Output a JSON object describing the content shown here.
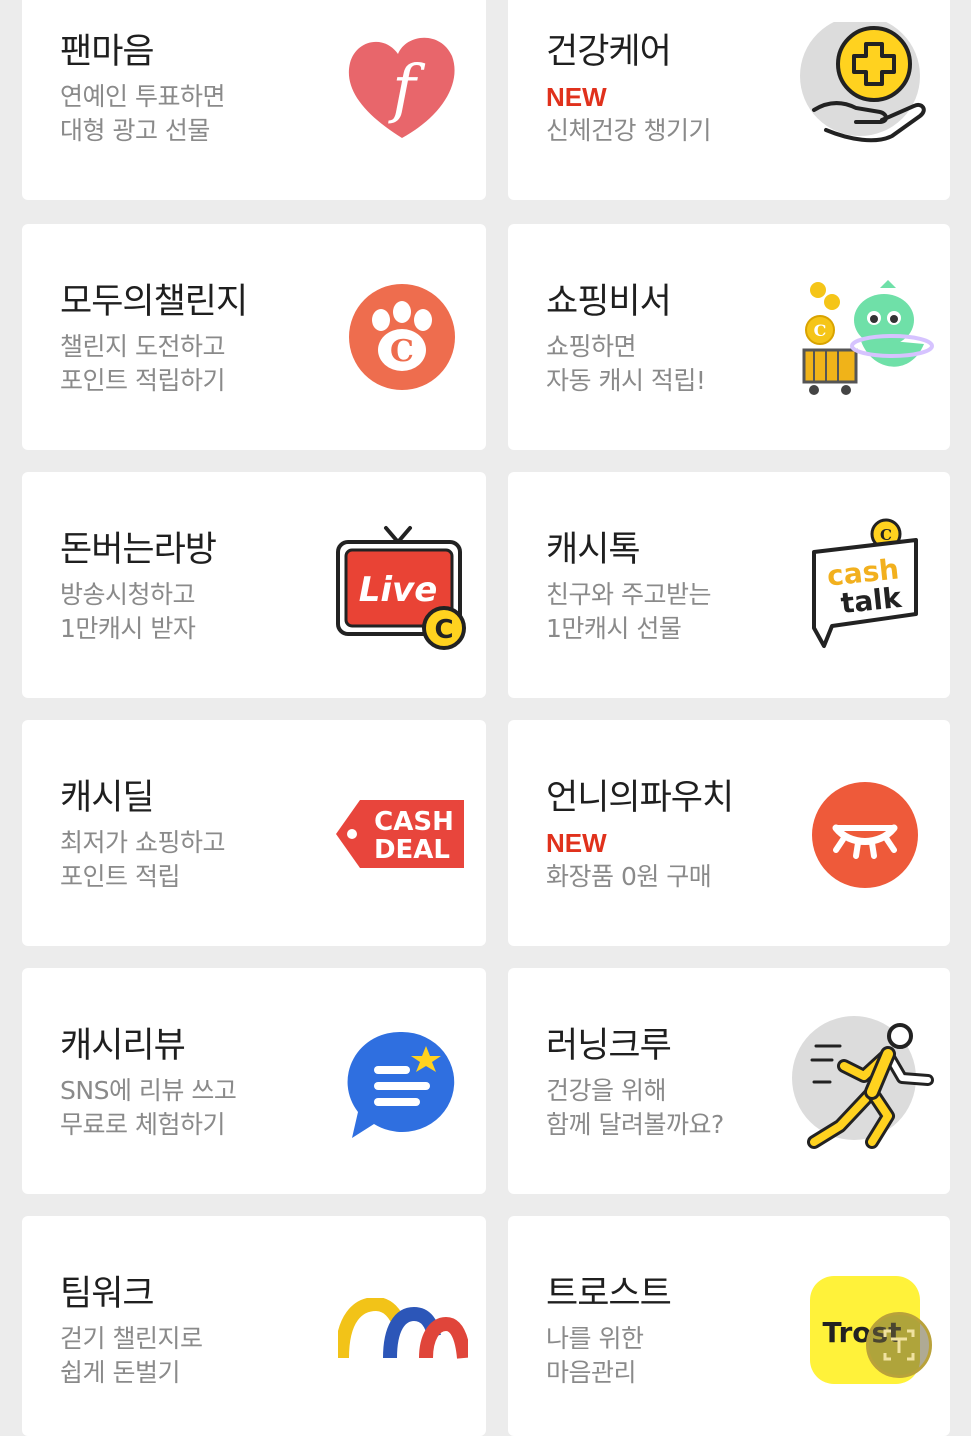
{
  "cards": [
    {
      "title": "팬마음",
      "line1": "연예인 투표하면",
      "line2": "대형 광고 선물",
      "icon": "heart-f-icon"
    },
    {
      "title": "건강케어",
      "line1": "NEW",
      "line2": "신체건강 챙기기",
      "icon": "hand-plus-icon"
    },
    {
      "title": "모두의챌린지",
      "line1": "챌린지 도전하고",
      "line2": "포인트 적립하기",
      "icon": "paw-coin-icon"
    },
    {
      "title": "쇼핑비서",
      "line1": "쇼핑하면",
      "line2": "자동 캐시 적립!",
      "icon": "cart-character-icon"
    },
    {
      "title": "돈버는라방",
      "line1": "방송시청하고",
      "line2": "1만캐시 받자",
      "icon": "live-tv-icon"
    },
    {
      "title": "캐시톡",
      "line1": "친구와 주고받는",
      "line2": "1만캐시 선물",
      "icon": "cash-talk-icon"
    },
    {
      "title": "캐시딜",
      "line1": "최저가 쇼핑하고",
      "line2": "포인트 적립",
      "icon": "cash-deal-tag-icon"
    },
    {
      "title": "언니의파우치",
      "line1": "NEW",
      "line2": "화장품 0원 구매",
      "icon": "pouch-eye-icon"
    },
    {
      "title": "캐시리뷰",
      "line1": "SNS에 리뷰 쓰고",
      "line2": "무료로 체험하기",
      "icon": "review-bubble-icon"
    },
    {
      "title": "러닝크루",
      "line1": "건강을 위해",
      "line2": "함께 달려볼까요?",
      "icon": "runner-icon"
    },
    {
      "title": "팀워크",
      "line1": "걷기 챌린지로",
      "line2": "쉽게 돈벌기",
      "icon": "arches-icon"
    },
    {
      "title": "트로스트",
      "line1": "나를 위한",
      "line2": "마음관리",
      "icon": "trost-logo-icon"
    }
  ],
  "icon_text": {
    "fanheart": "f",
    "live": "Live",
    "coin": "C",
    "cash": "cash",
    "talk": "talk",
    "cash_deal_1": "CASH",
    "cash_deal_2": "DEAL",
    "trost": "Trost"
  },
  "colors": {
    "new": "#e0311c",
    "background": "#ececec",
    "card": "#ffffff",
    "title": "#1f1f1f",
    "subtitle": "#8a8a8a"
  }
}
